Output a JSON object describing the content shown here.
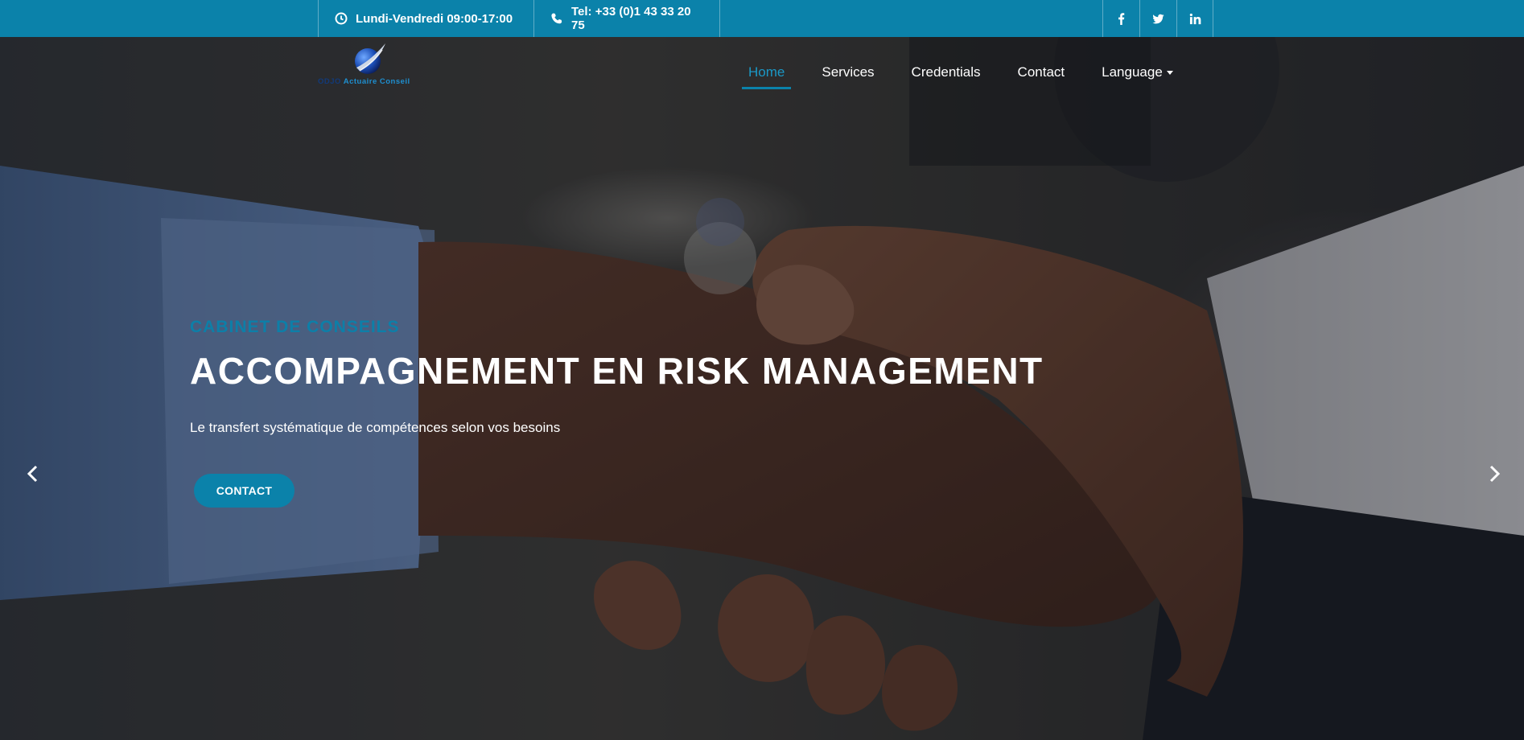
{
  "topbar": {
    "hours": "Lundi-Vendredi 09:00-17:00",
    "phone": "Tel: +33 (0)1 43 33 20 75",
    "hours_icon": "clock-icon",
    "phone_icon": "phone-icon",
    "socials": [
      "facebook-icon",
      "twitter-icon",
      "linkedin-icon"
    ],
    "background": "#0b82aa"
  },
  "logo": {
    "part1": "ODJO",
    "part2": "Actuaire Conseil"
  },
  "nav": {
    "items": [
      {
        "label": "Home",
        "active": true
      },
      {
        "label": "Services"
      },
      {
        "label": "Credentials"
      },
      {
        "label": "Contact"
      },
      {
        "label": "Language"
      }
    ],
    "active_color": "#1b98c6"
  },
  "hero": {
    "eyebrow": "CABINET DE CONSEILS",
    "headline": "ACCOMPAGNEMENT EN RISK MANAGEMENT",
    "subline": "Le transfert systématique de compétences selon vos besoins",
    "cta": "CONTACT",
    "prev_icon": "chevron-left-icon",
    "next_icon": "chevron-right-icon"
  },
  "colors": {
    "accent": "#0b82aa"
  }
}
